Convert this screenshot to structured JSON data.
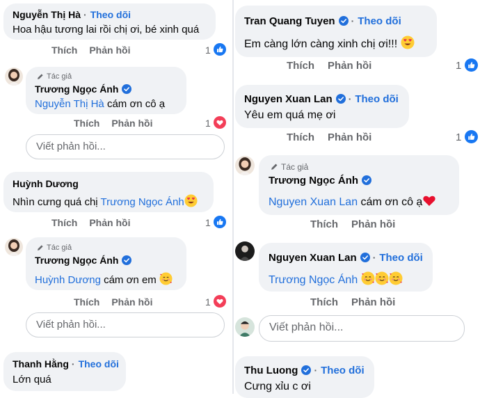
{
  "labels": {
    "follow": "Theo dõi",
    "like": "Thích",
    "reply": "Phản hồi",
    "author_tag": "Tác giả",
    "reply_placeholder": "Viết phản hồi...",
    "dot": "·"
  },
  "left": {
    "c1": {
      "author": "Nguyễn Thị Hà",
      "text": "Hoa hậu tương lai rồi chị ơi, bé xinh quá",
      "reactions": "1",
      "reaction_type": "like"
    },
    "r1": {
      "author": "Trương Ngọc Ánh",
      "mention": "Nguyễn Thị Hà",
      "text": " cám ơn cô ạ",
      "reactions": "1",
      "reaction_type": "love"
    },
    "c2": {
      "author": "Huỳnh Dương",
      "text": "Nhìn cưng quá chị ",
      "mention": "Trương Ngọc Ánh",
      "reactions": "1",
      "reaction_type": "like"
    },
    "r2": {
      "author": "Trương Ngọc Ánh",
      "mention": "Huỳnh Dương",
      "text": " cám ơn em ",
      "reactions": "1",
      "reaction_type": "love"
    },
    "c3": {
      "author": "Thanh Hằng",
      "text": "Lớn quá"
    }
  },
  "right": {
    "c1": {
      "author": "Tran Quang Tuyen",
      "text": "Em càng lớn càng xinh chị ơi!!! ",
      "reactions": "1",
      "reaction_type": "like"
    },
    "c2": {
      "author": "Nguyen Xuan Lan",
      "text": "Yêu em quá mẹ ơi",
      "reactions": "1",
      "reaction_type": "like"
    },
    "r1": {
      "author": "Trương Ngọc Ánh",
      "mention": "Nguyen Xuan Lan",
      "text": " cám ơn cô ạ"
    },
    "r2": {
      "author": "Nguyen Xuan Lan",
      "mention": "Trương Ngọc Ánh"
    },
    "c3": {
      "author": "Thu Luong",
      "text": "Cưng xỉu c ơi"
    }
  },
  "colors": {
    "link": "#216fdb",
    "bubble": "#f0f2f5",
    "muted": "#65676b",
    "like": "#1877f2",
    "love": "#f33e58"
  }
}
